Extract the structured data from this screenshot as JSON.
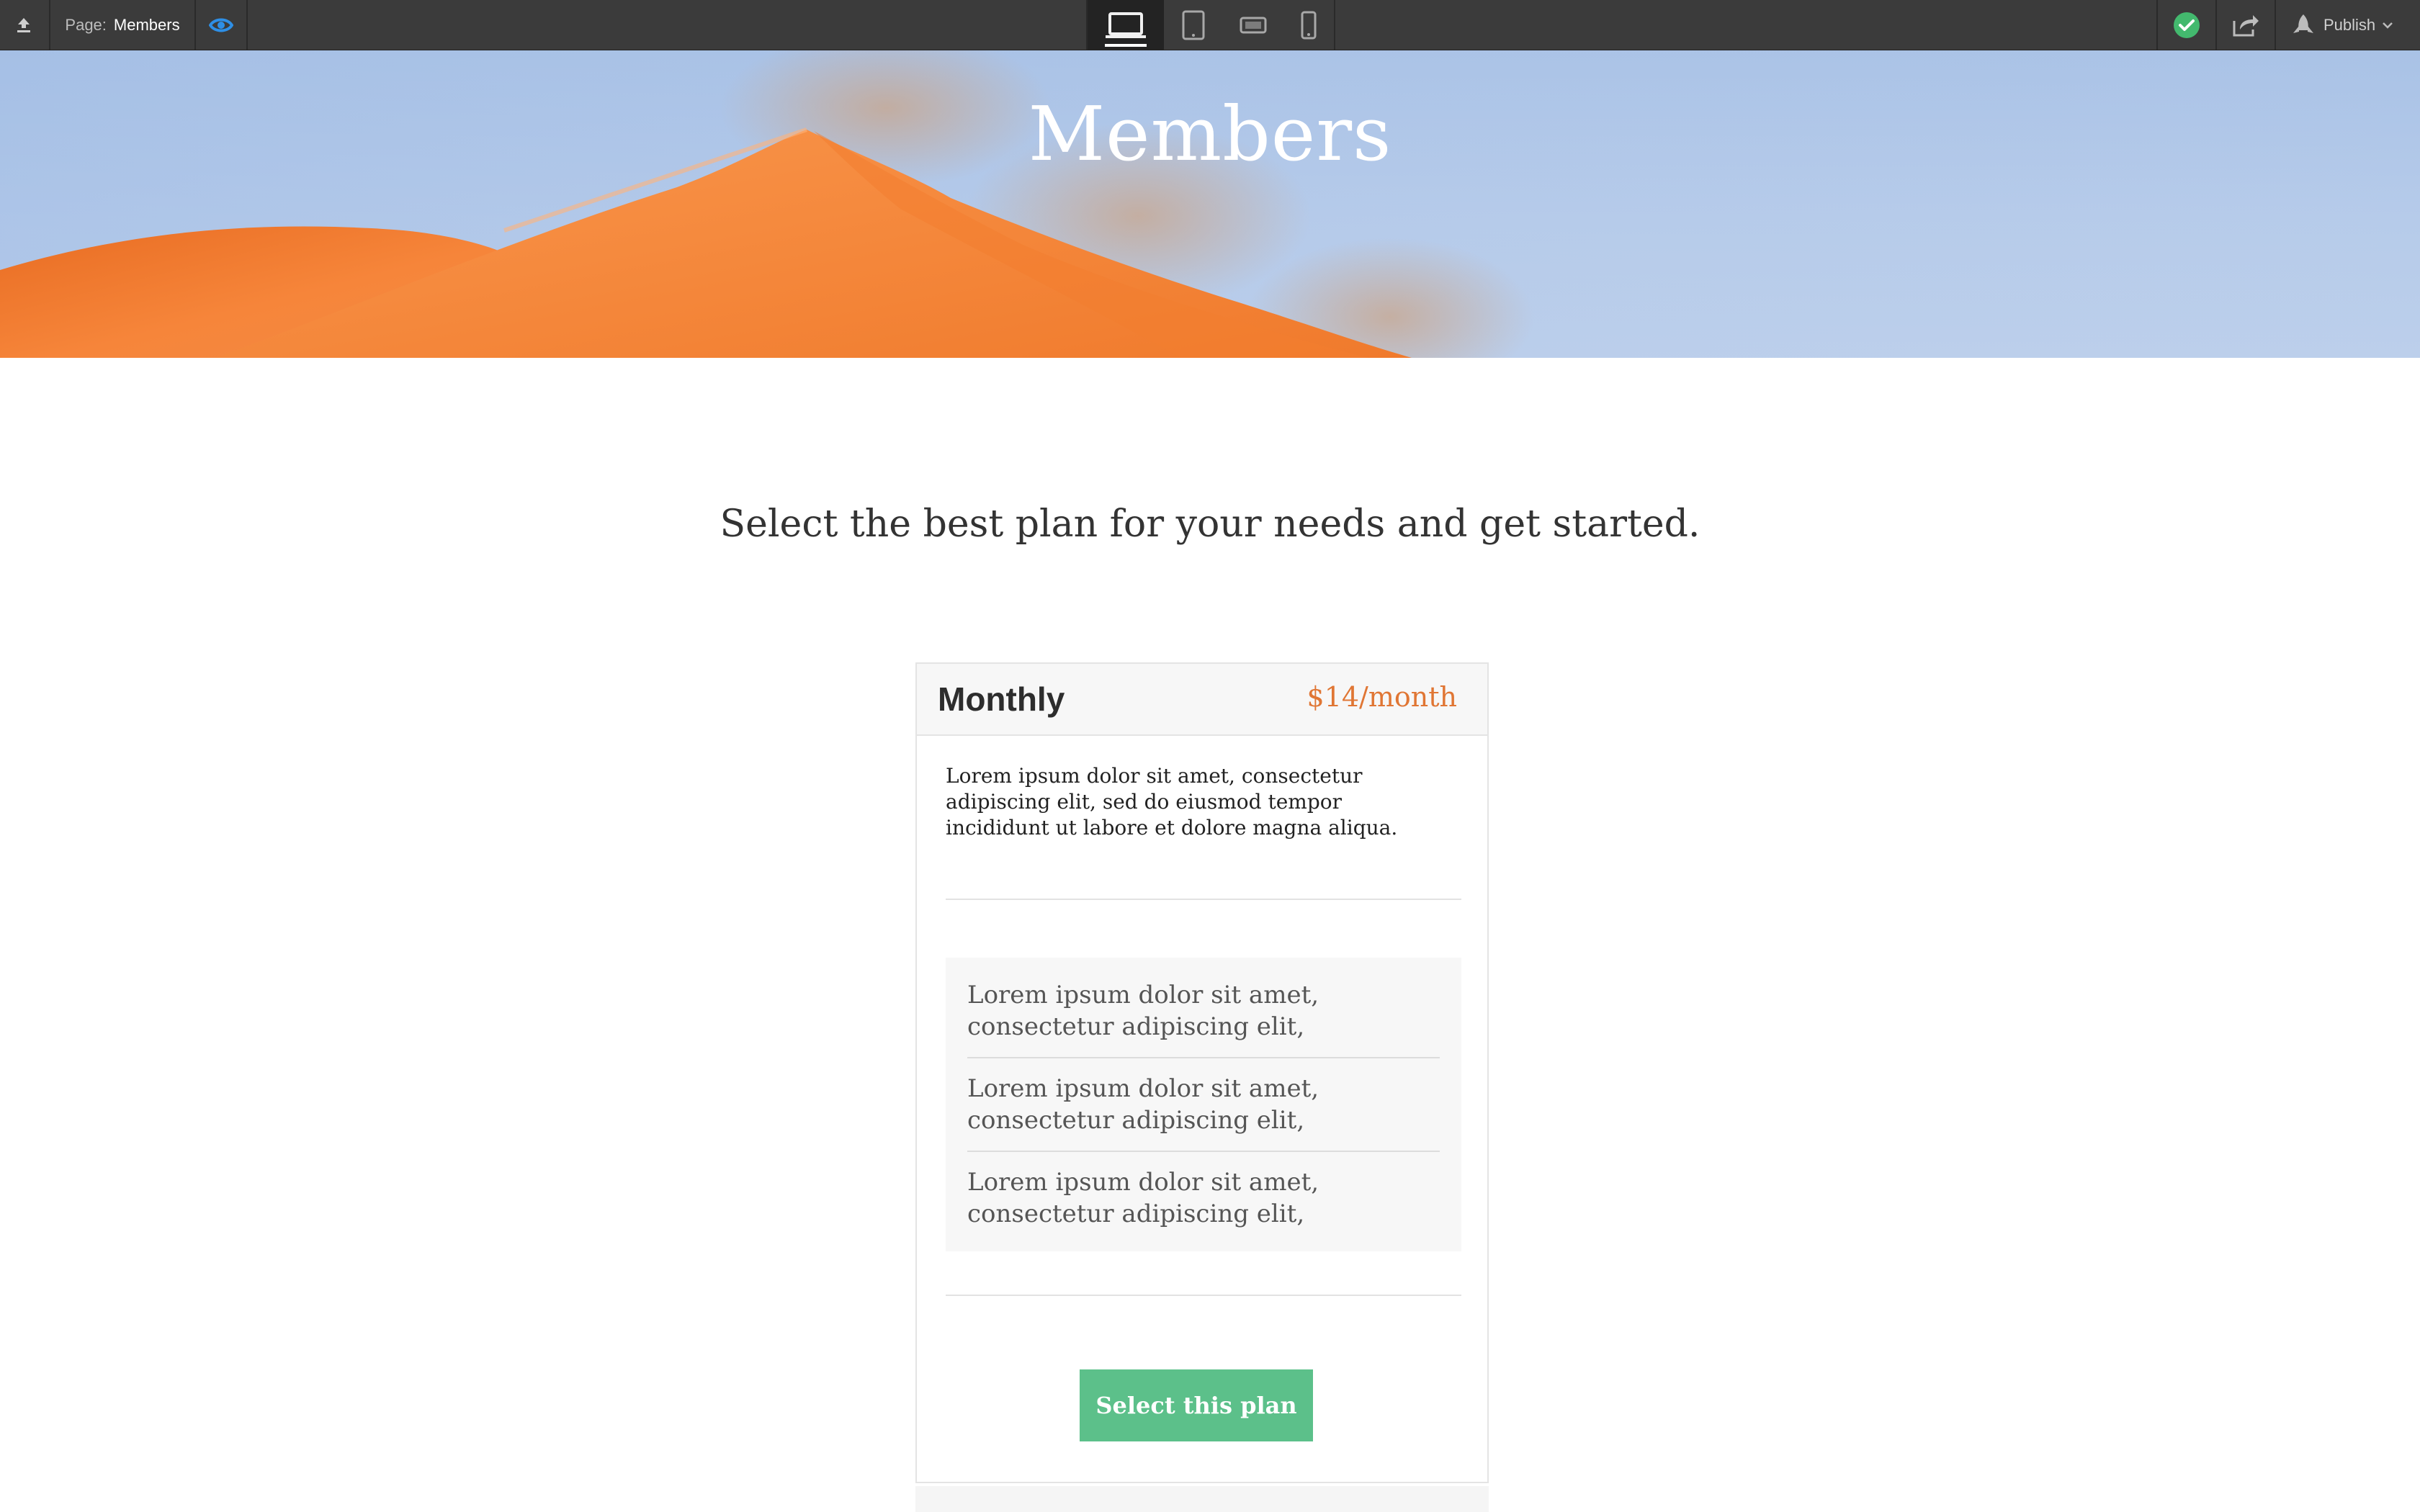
{
  "toolbar": {
    "page_label": "Page:",
    "page_name": "Members",
    "publish_label": "Publish",
    "icons": {
      "upload": "upload-icon",
      "preview": "eye-icon",
      "devices": [
        "desktop-icon",
        "tablet-icon",
        "tablet-landscape-icon",
        "phone-icon"
      ],
      "status": "check-circle-icon",
      "share": "share-icon",
      "publish": "rocket-icon",
      "dropdown": "chevron-down-icon"
    },
    "colors": {
      "bar": "#3b3b3b",
      "eye": "#2e8fe6",
      "status": "#43b96e"
    }
  },
  "hero": {
    "title": "Members"
  },
  "main": {
    "subtitle": "Select the best plan for your needs and get started."
  },
  "plan": {
    "name": "Monthly",
    "price": "$14/month",
    "description": "Lorem ipsum dolor sit amet, consectetur adipiscing elit, sed do eiusmod tempor incididunt ut labore et dolore magna aliqua.",
    "features": [
      "Lorem ipsum dolor sit amet, consectetur adipiscing elit,",
      "Lorem ipsum dolor sit amet, consectetur adipiscing elit,",
      "Lorem ipsum dolor sit amet, consectetur adipiscing elit,"
    ],
    "cta_label": "Select this plan",
    "colors": {
      "price": "#e07634",
      "cta": "#5cc08a"
    }
  }
}
